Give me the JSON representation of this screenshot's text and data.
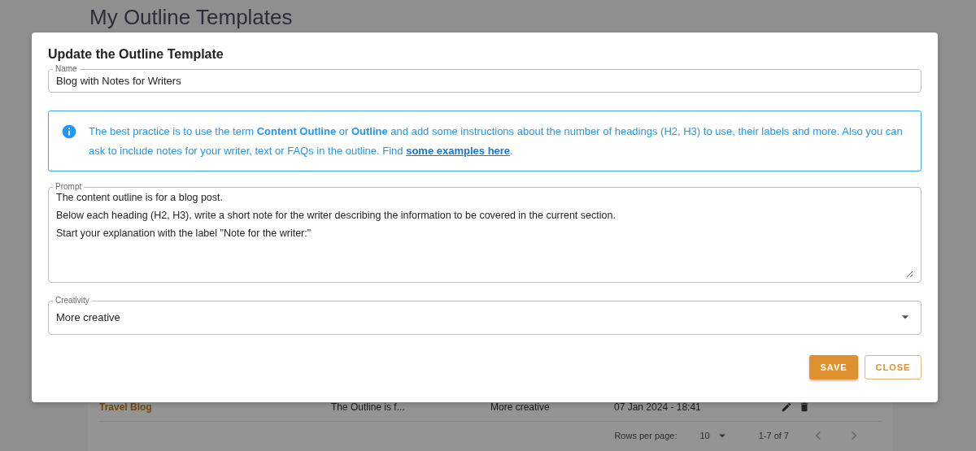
{
  "page": {
    "title": "My Outline Templates"
  },
  "table": {
    "rows": [
      {
        "name": "Travel Blog",
        "prompt": "The Outline is f...",
        "creativity": "More creative",
        "date": "07 Jan 2024 - 18:41"
      }
    ],
    "pagination": {
      "rows_per_page_label": "Rows per page:",
      "rows_per_page": "10",
      "range": "1-7 of 7"
    }
  },
  "dialog": {
    "title": "Update the Outline Template",
    "name_field": {
      "label": "Name",
      "value": "Blog with Notes for Writers"
    },
    "info": {
      "text": "The best practice is to use the term **Content Outline** or **Outline** and add some instructions about the number of headings (H2, H3) to use, their labels and more. Also you can ask to include notes for your writer, text or FAQs in the outline. Find ",
      "link": "some examples here",
      "end": "."
    },
    "prompt_field": {
      "label": "Prompt",
      "lines": [
        "The content outline is for a blog post.",
        "Below each heading (H2, H3), write a short note for the writer describing the information to be covered in the current section.",
        "Start your explanation with the label \"Note for the writer:\""
      ]
    },
    "creativity_field": {
      "label": "Creativity",
      "value": "More creative"
    },
    "buttons": [
      {
        "label": "SAVE",
        "kind": "primary"
      },
      {
        "label": "CLOSE",
        "kind": "outlined"
      }
    ]
  }
}
